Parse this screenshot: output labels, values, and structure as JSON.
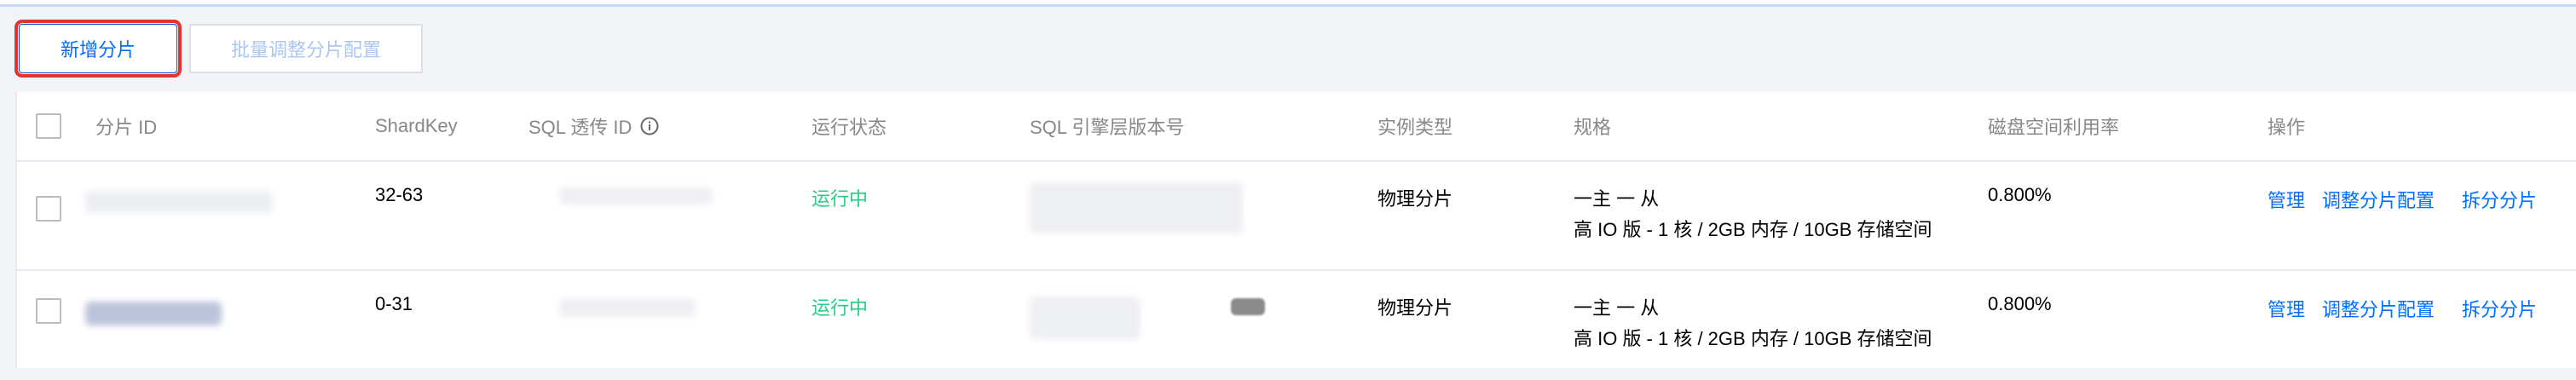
{
  "toolbar": {
    "add_shard_label": "新增分片",
    "batch_adjust_label": "批量调整分片配置"
  },
  "table": {
    "columns": {
      "shard_id": "分片 ID",
      "shard_key": "ShardKey",
      "sql_passthrough_id": "SQL 透传 ID",
      "status": "运行状态",
      "sql_engine_version": "SQL 引擎层版本号",
      "instance_type": "实例类型",
      "spec": "规格",
      "disk_usage": "磁盘空间利用率",
      "actions": "操作"
    },
    "rows": [
      {
        "shard_key": "32-63",
        "status": "运行中",
        "instance_type": "物理分片",
        "spec_line1": "一主 一 从",
        "spec_line2": "高 IO 版 - 1 核 / 2GB 内存 / 10GB 存储空间",
        "disk_usage": "0.800%",
        "action_manage": "管理",
        "action_adjust": "调整分片配置",
        "action_split": "拆分分片"
      },
      {
        "shard_key": "0-31",
        "status": "运行中",
        "instance_type": "物理分片",
        "spec_line1": "一主 一 从",
        "spec_line2": "高 IO 版 - 1 核 / 2GB 内存 / 10GB 存储空间",
        "disk_usage": "0.800%",
        "action_manage": "管理",
        "action_adjust": "调整分片配置",
        "action_split": "拆分分片"
      }
    ]
  },
  "colors": {
    "link": "#006eff",
    "status_running": "#29cc85",
    "highlight_outline": "#e3342f",
    "header_text": "#888888"
  },
  "icons": {
    "info": "info-circle-icon"
  }
}
